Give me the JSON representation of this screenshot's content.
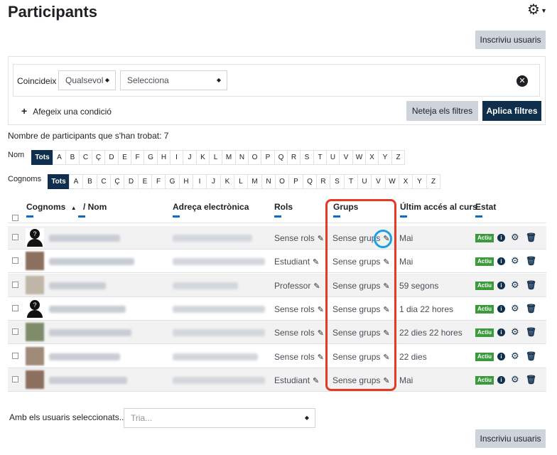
{
  "page": {
    "title": "Participants",
    "enrol_label": "Inscriviu usuaris",
    "enrol_label_bottom": "Inscriviu usuaris"
  },
  "filters": {
    "match_label": "Coincideix",
    "match_value": "Qualsevol",
    "select_value": "Selecciona",
    "add_condition": "Afegeix una condició",
    "clear_filters": "Neteja els filtres",
    "apply_filters": "Aplica filtres"
  },
  "count_text": "Nombre de participants que s'han trobat: 7",
  "initials": {
    "first_label": "Nom",
    "last_label": "Cognoms",
    "all_label": "Tots",
    "letters": [
      "A",
      "B",
      "C",
      "Ç",
      "D",
      "E",
      "F",
      "G",
      "H",
      "I",
      "J",
      "K",
      "L",
      "M",
      "N",
      "O",
      "P",
      "Q",
      "R",
      "S",
      "T",
      "U",
      "V",
      "W",
      "X",
      "Y",
      "Z"
    ]
  },
  "table": {
    "headers": {
      "surname": "Cognoms",
      "sort_arrow": "▲",
      "name": "/ Nom",
      "email": "Adreça electrònica",
      "roles": "Rols",
      "groups": "Grups",
      "last_access": "Últim accés al curs",
      "status": "Estat"
    },
    "rows": [
      {
        "role": "Sense rols",
        "groups": "Sense grups",
        "last_access": "Mai",
        "status": "Actiu",
        "avatar": "default"
      },
      {
        "role": "Estudiant",
        "groups": "Sense grups",
        "last_access": "Mai",
        "status": "Actiu",
        "avatar": "photo"
      },
      {
        "role": "Professor",
        "groups": "Sense grups",
        "last_access": "59 segons",
        "status": "Actiu",
        "avatar": "photo"
      },
      {
        "role": "Sense rols",
        "groups": "Sense grups",
        "last_access": "1 dia 22 hores",
        "status": "Actiu",
        "avatar": "default"
      },
      {
        "role": "Sense rols",
        "groups": "Sense grups",
        "last_access": "22 dies 22 hores",
        "status": "Actiu",
        "avatar": "photo"
      },
      {
        "role": "Sense rols",
        "groups": "Sense grups",
        "last_access": "22 dies",
        "status": "Actiu",
        "avatar": "photo"
      },
      {
        "role": "Estudiant",
        "groups": "Sense grups",
        "last_access": "Mai",
        "status": "Actiu",
        "avatar": "photo"
      }
    ]
  },
  "bulk": {
    "label": "Amb els usuaris seleccionats...",
    "placeholder": "Tria..."
  },
  "icons": {
    "settings": "gear-icon",
    "pencil": "pencil-icon",
    "info": "info-icon",
    "delete": "trash-icon"
  },
  "colors": {
    "brand_dark": "#0f2f4d",
    "active_badge": "#3b9a3b",
    "highlight_red": "#e23b25",
    "highlight_blue": "#1aa0e6"
  }
}
